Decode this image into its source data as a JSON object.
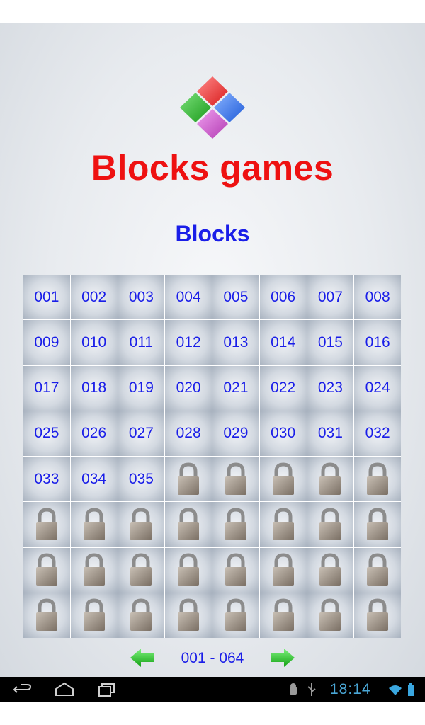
{
  "app": {
    "title": "Blocks games",
    "subtitle": "Blocks",
    "colors": {
      "title": "#ee1111",
      "subtitle": "#1a1ee8",
      "cell_text": "#1a1ee8"
    }
  },
  "levels": {
    "unlocked": [
      "001",
      "002",
      "003",
      "004",
      "005",
      "006",
      "007",
      "008",
      "009",
      "010",
      "011",
      "012",
      "013",
      "014",
      "015",
      "016",
      "017",
      "018",
      "019",
      "020",
      "021",
      "022",
      "023",
      "024",
      "025",
      "026",
      "027",
      "028",
      "029",
      "030",
      "031",
      "032",
      "033",
      "034",
      "035"
    ],
    "locked_count": 29,
    "locked_icon": "padlock-icon"
  },
  "pager": {
    "range": "001 - 064",
    "prev_icon": "green-left-arrow-icon",
    "next_icon": "green-right-arrow-icon"
  },
  "system_bar": {
    "time": "18:14",
    "nav_icons": [
      "back-icon",
      "home-icon",
      "recent-apps-icon"
    ],
    "status_icons": [
      "android-debug-icon",
      "usb-icon",
      "wifi-icon",
      "battery-icon"
    ]
  }
}
